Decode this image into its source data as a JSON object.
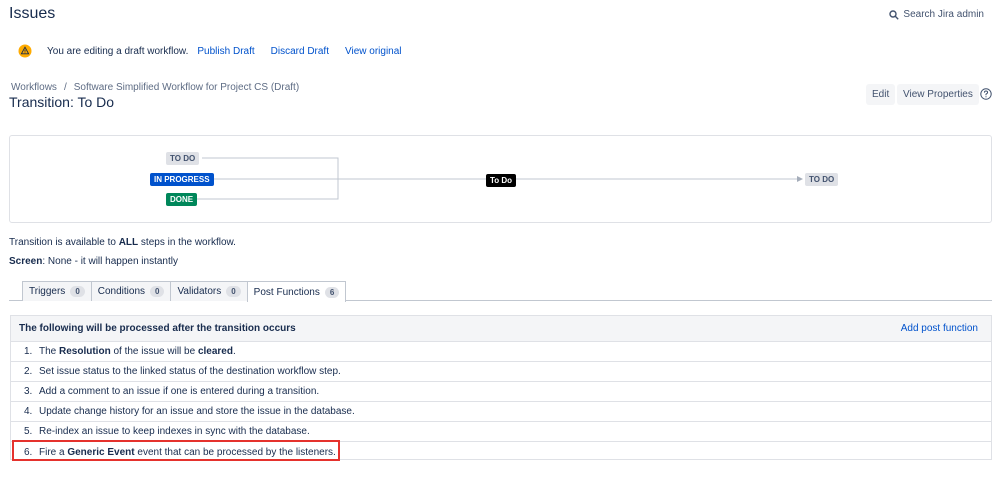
{
  "header": {
    "title": "Issues",
    "search_label": "Search Jira admin"
  },
  "draft": {
    "message": "You are editing a draft workflow.",
    "publish": "Publish Draft",
    "discard": "Discard Draft",
    "view_original": "View original"
  },
  "breadcrumb": {
    "root": "Workflows",
    "separator": "/",
    "current": "Software Simplified Workflow for Project CS (Draft)"
  },
  "transition": {
    "title": "Transition: To Do"
  },
  "actions": {
    "edit": "Edit",
    "view_properties": "View Properties"
  },
  "diagram": {
    "sources": [
      "TO DO",
      "IN PROGRESS",
      "DONE"
    ],
    "transition_label": "To Do",
    "target": "TO DO"
  },
  "info": {
    "available_pre": "Transition is available to ",
    "available_bold": "ALL",
    "available_post": " steps in the workflow.",
    "screen_label": "Screen",
    "screen_value": ": None - it will happen instantly"
  },
  "tabs": [
    {
      "label": "Triggers",
      "count": "0"
    },
    {
      "label": "Conditions",
      "count": "0"
    },
    {
      "label": "Validators",
      "count": "0"
    },
    {
      "label": "Post Functions",
      "count": "6"
    }
  ],
  "post_functions": {
    "heading": "The following will be processed after the transition occurs",
    "add_label": "Add post function",
    "items": [
      {
        "num": "1.",
        "p1": "The ",
        "b1": "Resolution",
        "p2": " of the issue will be ",
        "b2": "cleared",
        "p3": "."
      },
      {
        "num": "2.",
        "p1": "Set issue status to the linked status of the destination workflow step."
      },
      {
        "num": "3.",
        "p1": "Add a comment to an issue if one is entered during a transition."
      },
      {
        "num": "4.",
        "p1": "Update change history for an issue and store the issue in the database."
      },
      {
        "num": "5.",
        "p1": "Re-index an issue to keep indexes in sync with the database."
      },
      {
        "num": "6.",
        "p1": "Fire a ",
        "b1": "Generic Event",
        "p2": " event that can be processed by the listeners."
      }
    ]
  },
  "colors": {
    "accent": "#0052cc",
    "success": "#00875a",
    "highlight": "#e5322d",
    "warning": "#ffab00"
  },
  "icons": {
    "search": "search-icon",
    "warning": "warning-icon",
    "help": "help-icon"
  }
}
